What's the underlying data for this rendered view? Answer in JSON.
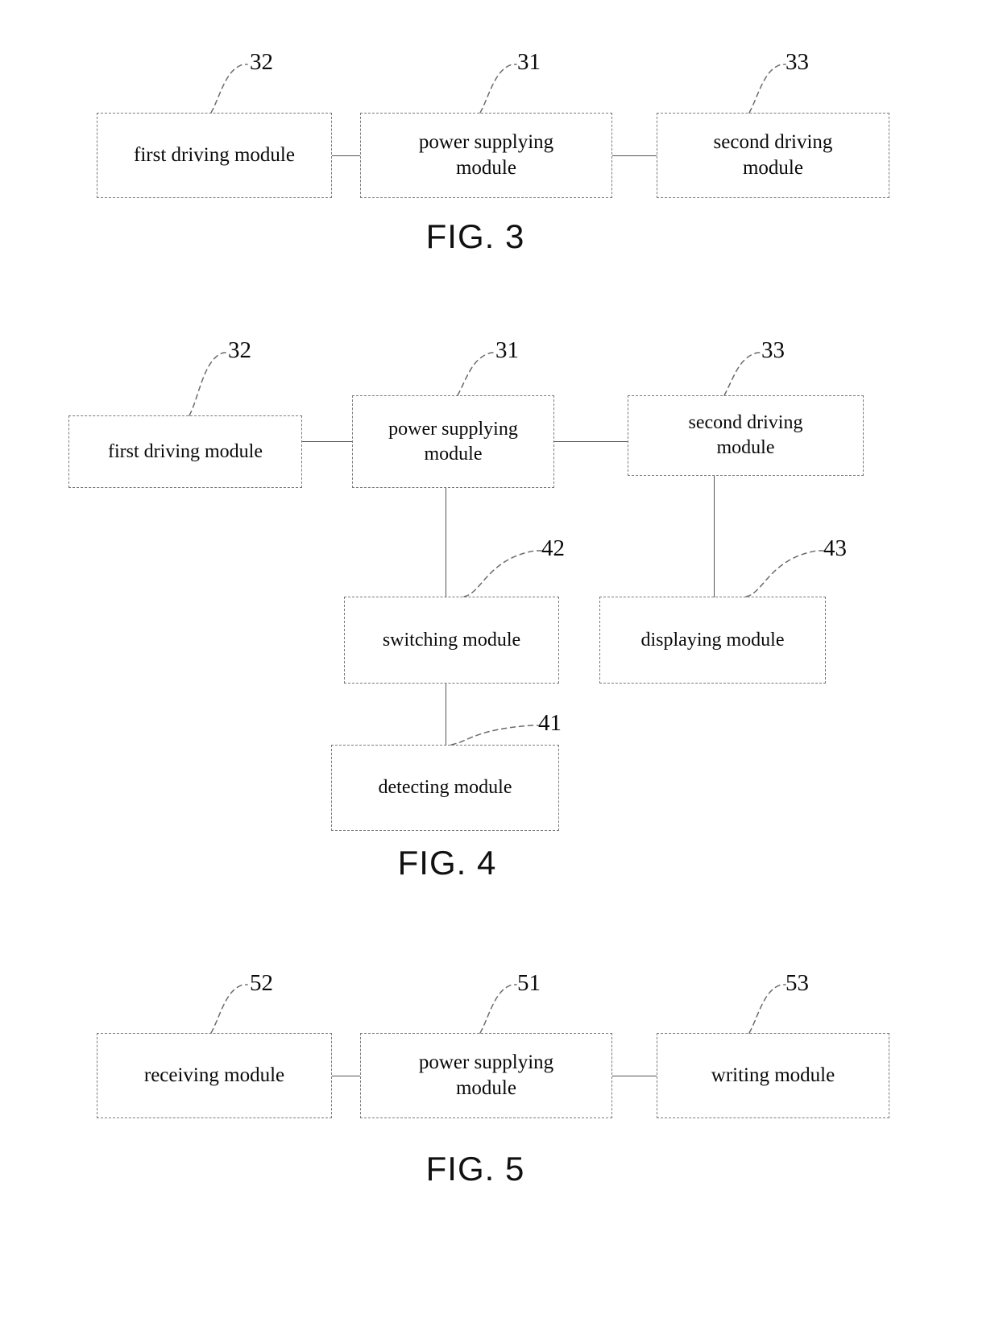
{
  "document": {
    "type": "patent-drawing-sheet",
    "figures": [
      {
        "id": "fig3",
        "caption": "FIG. 3",
        "blocks": [
          {
            "ref": "32",
            "label": "first driving module"
          },
          {
            "ref": "31",
            "label": "power supplying\nmodule"
          },
          {
            "ref": "33",
            "label": "second driving\nmodule"
          }
        ],
        "connections": [
          {
            "from": "32",
            "to": "31"
          },
          {
            "from": "31",
            "to": "33"
          }
        ]
      },
      {
        "id": "fig4",
        "caption": "FIG. 4",
        "blocks": [
          {
            "ref": "32",
            "label": "first driving module"
          },
          {
            "ref": "31",
            "label": "power supplying\nmodule"
          },
          {
            "ref": "33",
            "label": "second driving\nmodule"
          },
          {
            "ref": "42",
            "label": "switching module"
          },
          {
            "ref": "43",
            "label": "displaying module"
          },
          {
            "ref": "41",
            "label": "detecting module"
          }
        ],
        "connections": [
          {
            "from": "32",
            "to": "31"
          },
          {
            "from": "31",
            "to": "33"
          },
          {
            "from": "31",
            "to": "42"
          },
          {
            "from": "33",
            "to": "43"
          },
          {
            "from": "42",
            "to": "41"
          }
        ]
      },
      {
        "id": "fig5",
        "caption": "FIG. 5",
        "blocks": [
          {
            "ref": "52",
            "label": "receiving module"
          },
          {
            "ref": "51",
            "label": "power supplying\nmodule"
          },
          {
            "ref": "53",
            "label": "writing module"
          }
        ],
        "connections": [
          {
            "from": "52",
            "to": "51"
          },
          {
            "from": "51",
            "to": "53"
          }
        ]
      }
    ]
  },
  "fig3": {
    "caption": "FIG. 3",
    "box_first_driving": "first driving module",
    "box_power_supplying": "power supplying\nmodule",
    "box_second_driving": "second driving\nmodule",
    "ref_first_driving": "32",
    "ref_power_supplying": "31",
    "ref_second_driving": "33"
  },
  "fig4": {
    "caption": "FIG. 4",
    "box_first_driving": "first driving module",
    "box_power_supplying": "power supplying\nmodule",
    "box_second_driving": "second driving\nmodule",
    "box_switching": "switching module",
    "box_displaying": "displaying module",
    "box_detecting": "detecting module",
    "ref_first_driving": "32",
    "ref_power_supplying": "31",
    "ref_second_driving": "33",
    "ref_switching": "42",
    "ref_displaying": "43",
    "ref_detecting": "41"
  },
  "fig5": {
    "caption": "FIG. 5",
    "box_receiving": "receiving module",
    "box_power_supplying": "power supplying\nmodule",
    "box_writing": "writing module",
    "ref_receiving": "52",
    "ref_power_supplying": "51",
    "ref_writing": "53"
  },
  "colors": {
    "box_border": "#7a7a7a",
    "connector": "#555555",
    "text": "#0a0a0a",
    "background": "#ffffff"
  }
}
